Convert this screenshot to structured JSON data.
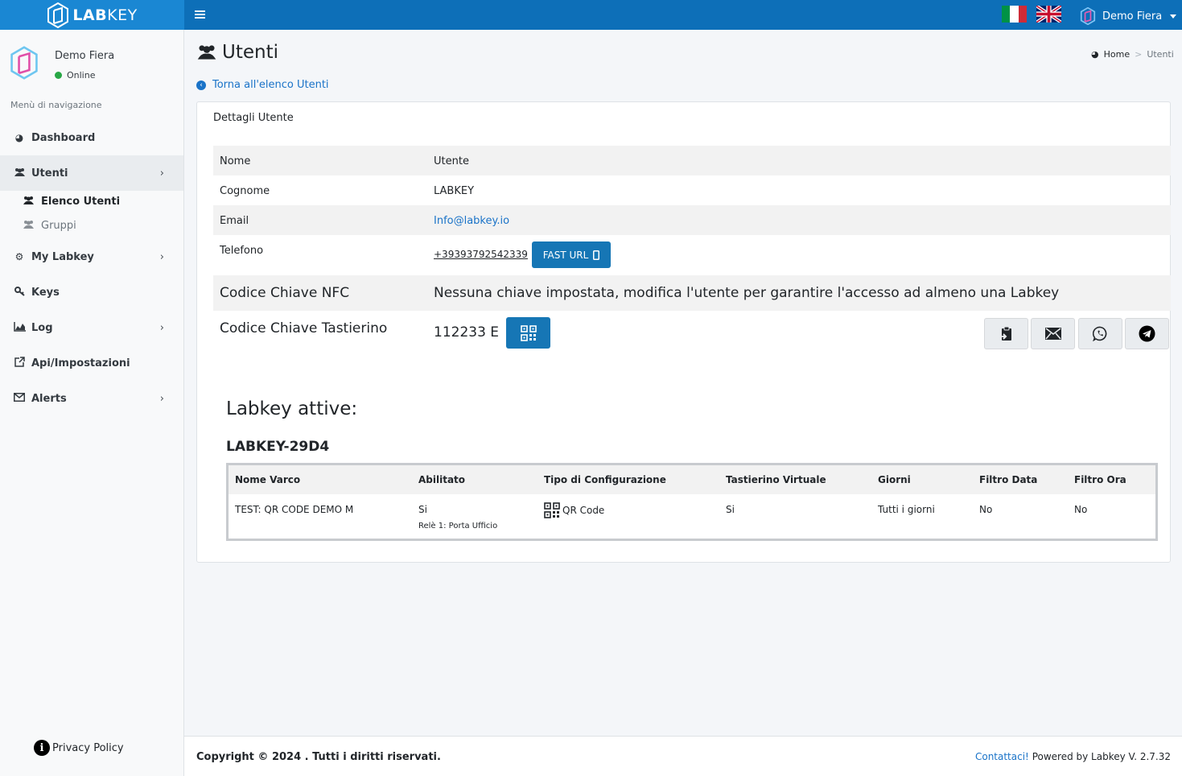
{
  "brand": {
    "lab": "LAB",
    "key": "KEY"
  },
  "topbar": {
    "user_name": "Demo Fiera"
  },
  "sidebar": {
    "user_name": "Demo Fiera",
    "status": "Online",
    "nav_header": "Menù di navigazione",
    "items": {
      "dashboard": "Dashboard",
      "utenti": "Utenti",
      "elenco_utenti": "Elenco Utenti",
      "gruppi": "Gruppi",
      "my_labkey": "My Labkey",
      "keys": "Keys",
      "log": "Log",
      "api": "Api/Impostazioni",
      "alerts": "Alerts"
    },
    "privacy": "Privacy Policy"
  },
  "page": {
    "title": "Utenti",
    "breadcrumb": {
      "home": "Home",
      "current": "Utenti"
    },
    "back_link": "Torna all'elenco Utenti"
  },
  "card": {
    "title": "Dettagli Utente",
    "rows": {
      "nome_label": "Nome",
      "nome_value": "Utente",
      "cognome_label": "Cognome",
      "cognome_value": "LABKEY",
      "email_label": "Email",
      "email_value": "Info@labkey.io",
      "telefono_label": "Telefono",
      "telefono_value": "+39393792542339",
      "fast_url": "FAST URL",
      "nfc_label": "Codice Chiave NFC",
      "nfc_value": "Nessuna chiave impostata, modifica l'utente per garantire l'accesso ad almeno una Labkey",
      "tastierino_label": "Codice Chiave Tastierino",
      "tastierino_value": "112233 E"
    },
    "labkey_heading": "Labkey attive:",
    "labkey_name": "LABKEY-29D4",
    "table": {
      "headers": {
        "nome_varco": "Nome Varco",
        "abilitato": "Abilitato",
        "tipo": "Tipo di Configurazione",
        "tastierino": "Tastierino Virtuale",
        "giorni": "Giorni",
        "filtro_data": "Filtro Data",
        "filtro_ora": "Filtro Ora"
      },
      "row": {
        "nome_varco": "TEST: QR CODE DEMO M",
        "abilitato": "Si",
        "rele": "Relè 1: Porta Ufficio",
        "tipo": "QR Code",
        "tastierino": "Si",
        "giorni": "Tutti i giorni",
        "filtro_data": "No",
        "filtro_ora": "No"
      }
    }
  },
  "footer": {
    "copyright": "Copyright © 2024 . Tutti i diritti riservati.",
    "contact": "Contattaci!",
    "powered": "Powered by Labkey V. 2.7.32"
  },
  "colors": {
    "primary": "#0d6fb8",
    "brand_bg": "#1a87d3",
    "button": "#1676b5",
    "link": "#1a73c8",
    "online": "#28a745"
  }
}
